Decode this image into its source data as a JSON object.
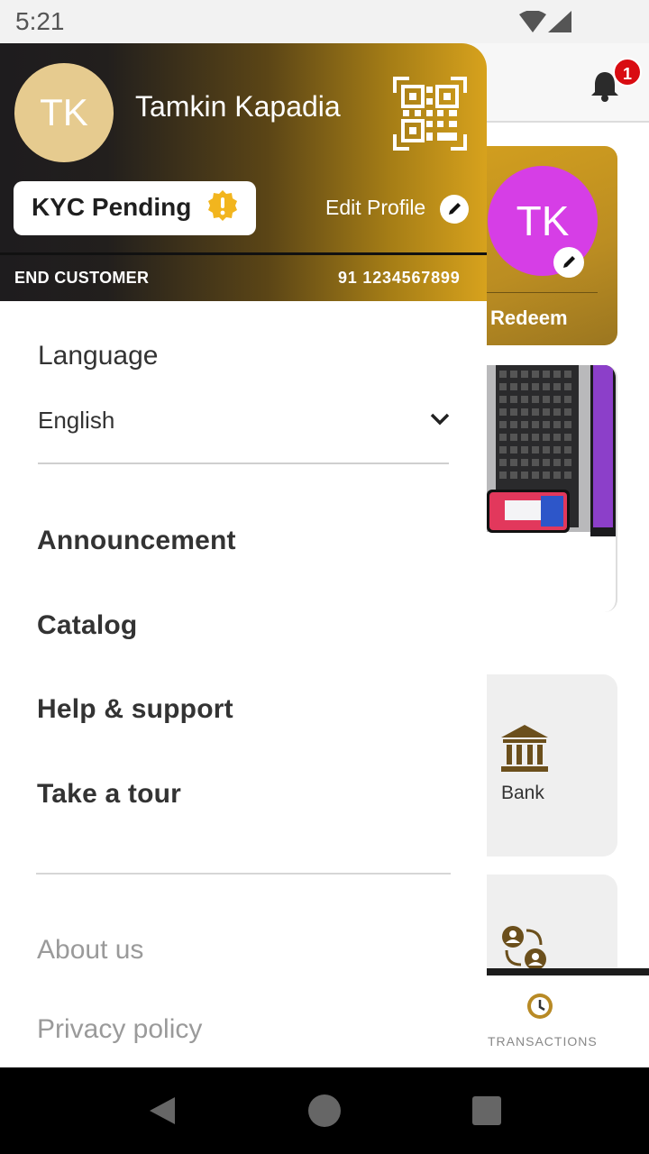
{
  "status_bar": {
    "time": "5:21"
  },
  "background": {
    "notification_count": "1",
    "avatar_initials": "TK",
    "redeem_label": "Redeem",
    "bank_label": "Bank",
    "transactions_label": "TRANSACTIONS"
  },
  "drawer": {
    "avatar_initials": "TK",
    "user_name": "Tamkin Kapadia",
    "kyc_status": "KYC Pending",
    "edit_profile_label": "Edit Profile",
    "role": "END CUSTOMER",
    "phone": "91 1234567899",
    "language": {
      "title": "Language",
      "selected": "English"
    },
    "menu_items": [
      "Announcement",
      "Catalog",
      "Help & support",
      "Take a tour"
    ],
    "links": [
      "About us",
      "Privacy policy"
    ]
  },
  "colors": {
    "gold": "#d7a21d",
    "dark": "#1e1c1e",
    "kyc_warning": "#f2b51e",
    "badge": "#d90c12",
    "avatar_bg": "#d63ee6"
  }
}
